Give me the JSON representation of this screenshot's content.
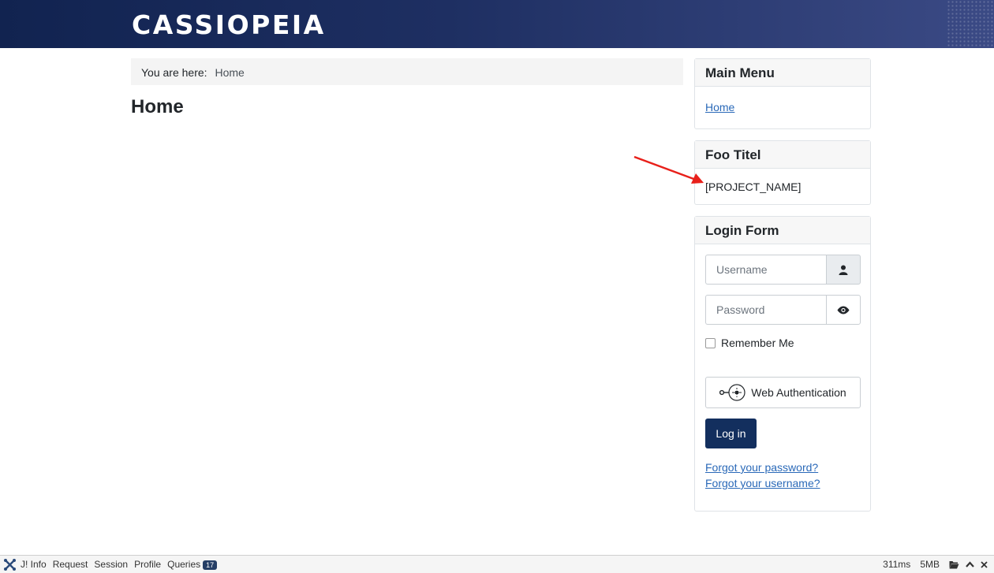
{
  "header": {
    "brand": "CASSIOPEIA"
  },
  "breadcrumb": {
    "label": "You are here:",
    "current": "Home"
  },
  "page": {
    "title": "Home"
  },
  "main_menu": {
    "title": "Main Menu",
    "items": [
      {
        "label": "Home"
      }
    ]
  },
  "foo_module": {
    "title": "Foo Titel",
    "content": "[PROJECT_NAME]"
  },
  "login_form": {
    "title": "Login Form",
    "username_placeholder": "Username",
    "password_placeholder": "Password",
    "remember_label": "Remember Me",
    "webauthn_label": "Web Authentication",
    "login_label": "Log in",
    "forgot_password": "Forgot your password?",
    "forgot_username": "Forgot your username?"
  },
  "debugbar": {
    "items": [
      "J! Info",
      "Request",
      "Session",
      "Profile",
      "Queries"
    ],
    "queries_count": "17",
    "time": "311ms",
    "memory": "5MB"
  },
  "colors": {
    "header_start": "#112350",
    "header_end": "#3b4a85",
    "link": "#2a69b8",
    "primary_button": "#132f5e",
    "annotation_arrow": "#e8201a"
  }
}
